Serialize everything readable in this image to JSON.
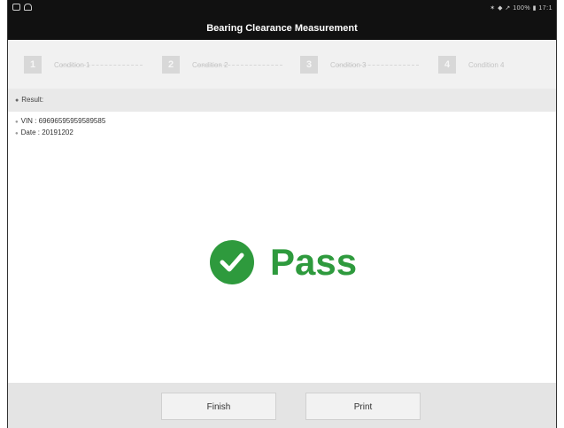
{
  "status_bar": {
    "right_text": "✶ ◆ ↗ 100% ▮ 17:1"
  },
  "header": {
    "title": "Bearing Clearance Measurement"
  },
  "steps": [
    {
      "number": "1",
      "label": "Condition 1"
    },
    {
      "number": "2",
      "label": "Condition 2"
    },
    {
      "number": "3",
      "label": "Condition 3"
    },
    {
      "number": "4",
      "label": "Condition 4"
    }
  ],
  "result": {
    "label": "Result:",
    "vin_label": "VIN : 69696595959589585",
    "date_label": "Date : 20191202",
    "status_text": "Pass",
    "status_color": "#2e9a3d"
  },
  "footer": {
    "finish_label": "Finish",
    "print_label": "Print"
  }
}
